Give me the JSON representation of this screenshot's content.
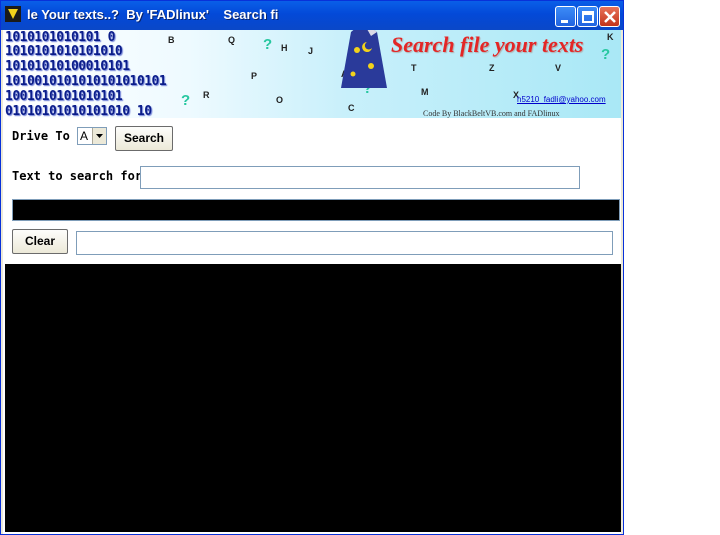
{
  "window": {
    "title": "le Your texts..?  By 'FADlinux'    Search fi"
  },
  "banner": {
    "binary_lines": [
      "1010101010101 0",
      "1010101010101010",
      "10101010100010101",
      "1010010101010101010101",
      "1001010101010101",
      "01010101010101010 10"
    ],
    "title": "Search file your texts",
    "email": "h5210_fadli@yahoo.com",
    "credit": "Code By BlackBeltVB.com and FADlinux",
    "letters": [
      "B",
      "Q",
      "H",
      "J",
      "P",
      "A",
      "T",
      "Z",
      "V",
      "K",
      "R",
      "O",
      "C",
      "M",
      "X"
    ]
  },
  "form": {
    "drive_label": "Drive To",
    "drive_value": "A",
    "search_button": "Search",
    "text_label": "Text to search for:",
    "search_text_value": "",
    "clear_button": "Clear",
    "status_value": ""
  },
  "colors": {
    "titlebar": "#0349d8",
    "banner_title": "#e32626",
    "binary_text": "#0b1d8a",
    "output_bg": "#000000"
  }
}
